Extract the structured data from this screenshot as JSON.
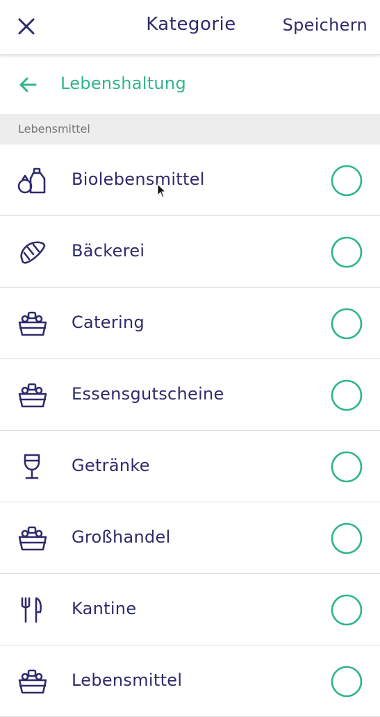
{
  "header": {
    "close_icon": "close-icon",
    "title": "Kategorie",
    "save_label": "Speichern"
  },
  "back": {
    "icon": "arrow-left-icon",
    "label": "Lebenshaltung"
  },
  "section": {
    "label": "Lebensmittel"
  },
  "colors": {
    "primary_text": "#2d2b6b",
    "accent": "#2fb58c",
    "section_bg": "#ededee"
  },
  "items": [
    {
      "label": "Biolebensmittel",
      "icon": "milk-bottle-icon",
      "selected": false
    },
    {
      "label": "Bäckerei",
      "icon": "croissant-icon",
      "selected": false
    },
    {
      "label": "Catering",
      "icon": "food-basket-icon",
      "selected": false
    },
    {
      "label": "Essensgutscheine",
      "icon": "food-basket-icon",
      "selected": false
    },
    {
      "label": "Getränke",
      "icon": "wine-glass-icon",
      "selected": false
    },
    {
      "label": "Großhandel",
      "icon": "food-basket-icon",
      "selected": false
    },
    {
      "label": "Kantine",
      "icon": "fork-knife-icon",
      "selected": false
    },
    {
      "label": "Lebensmittel",
      "icon": "food-basket-icon",
      "selected": false
    }
  ]
}
